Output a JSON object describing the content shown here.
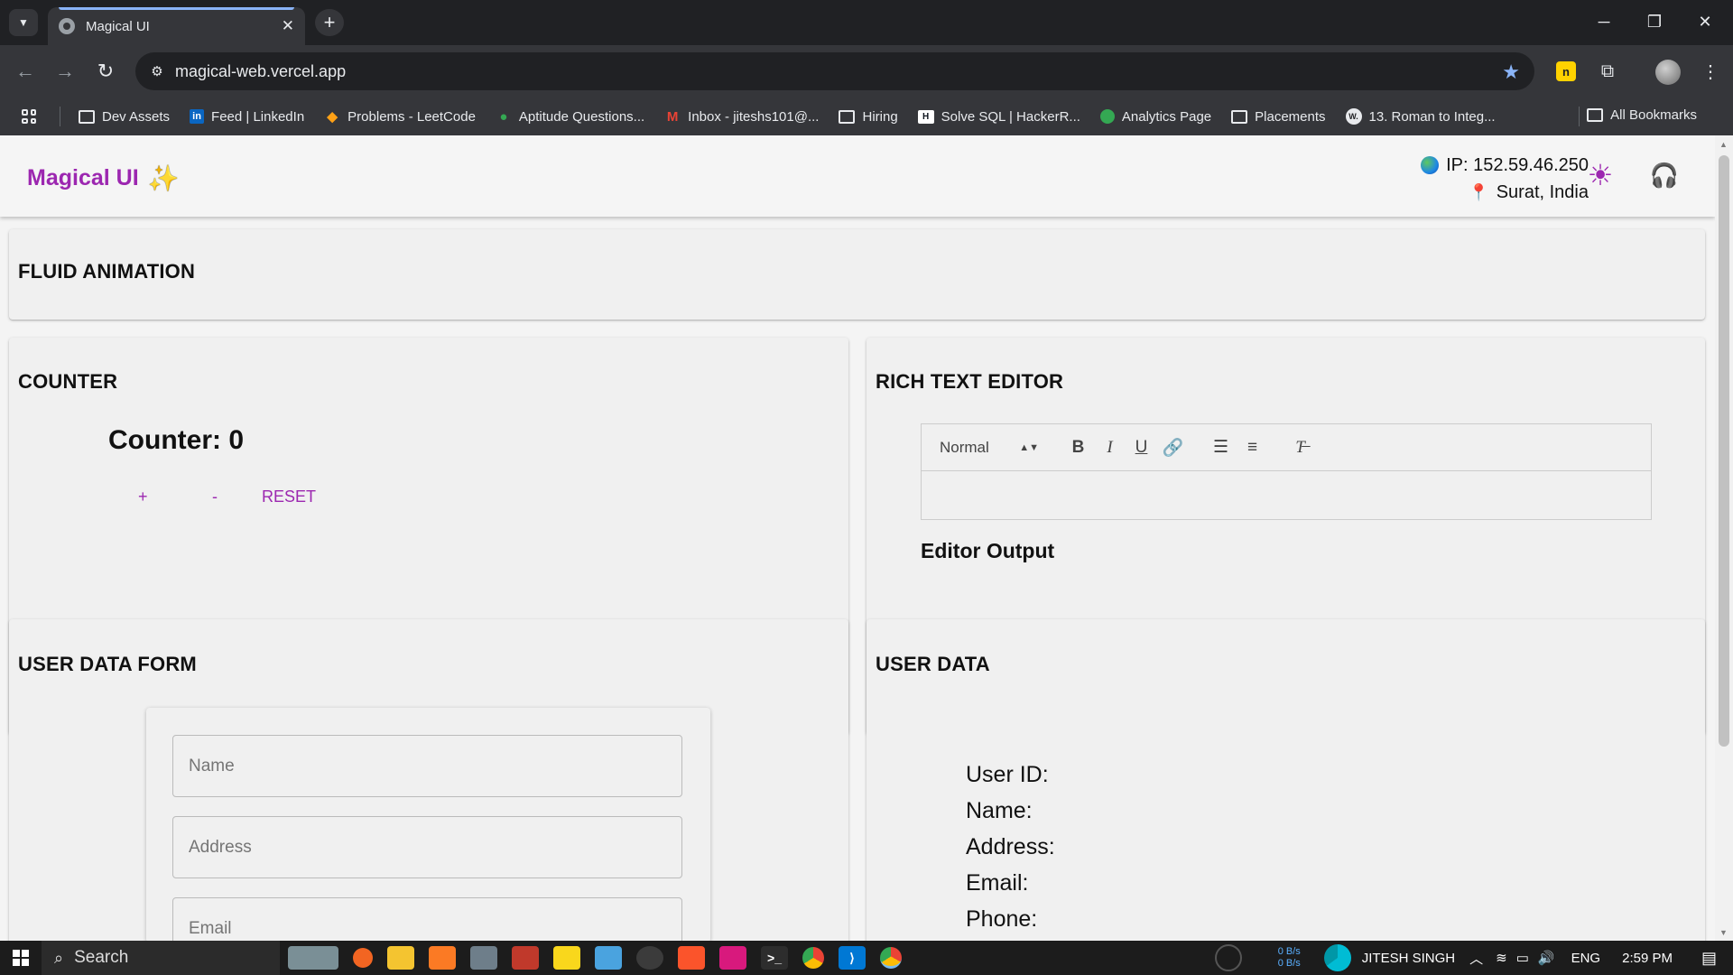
{
  "browser": {
    "tab_title": "Magical UI",
    "tab_close": "✕",
    "new_tab": "+",
    "url": "magical-web.vercel.app",
    "bookmarks": [
      {
        "label": "Dev Assets",
        "icon": "folder-icon"
      },
      {
        "label": "Feed | LinkedIn",
        "icon": "linkedin-icon"
      },
      {
        "label": "Problems - LeetCode",
        "icon": "leetcode-icon"
      },
      {
        "label": "Aptitude Questions...",
        "icon": "aptitude-icon"
      },
      {
        "label": "Inbox - jiteshs101@...",
        "icon": "gmail-icon"
      },
      {
        "label": "Hiring",
        "icon": "folder-icon"
      },
      {
        "label": "Solve SQL | HackerR...",
        "icon": "hackerrank-icon"
      },
      {
        "label": "Analytics Page",
        "icon": "analytics-icon"
      },
      {
        "label": "Placements",
        "icon": "folder-icon"
      },
      {
        "label": "13. Roman to Integ...",
        "icon": "w-icon"
      }
    ],
    "all_bookmarks": "All Bookmarks"
  },
  "header": {
    "brand": "Magical UI",
    "ip_text": "IP: 152.59.46.250",
    "location_text": "Surat, India"
  },
  "sections": {
    "fluid": {
      "title": "FLUID ANIMATION"
    },
    "counter": {
      "title": "COUNTER",
      "value_text": "Counter: 0",
      "increment": "+",
      "decrement": "-",
      "reset": "RESET"
    },
    "editor": {
      "title": "RICH TEXT EDITOR",
      "format_select": "Normal",
      "bold": "B",
      "italic": "I",
      "underline": "U",
      "output_label": "Editor Output"
    },
    "form": {
      "title": "USER DATA FORM",
      "name_placeholder": "Name",
      "address_placeholder": "Address",
      "email_placeholder": "Email"
    },
    "user_data": {
      "title": "USER DATA",
      "labels": [
        "User ID:",
        "Name:",
        "Address:",
        "Email:",
        "Phone:"
      ]
    }
  },
  "taskbar": {
    "search_placeholder": "Search",
    "net_up": "0 B/s",
    "net_down": "0 B/s",
    "user_name": "JITESH SINGH",
    "language": "ENG",
    "time": "2:59 PM"
  },
  "colors": {
    "accent": "#9c27b0",
    "support": "#1e88e5",
    "page_bg": "#f4f4f4",
    "card_bg": "#f0f0f0"
  }
}
